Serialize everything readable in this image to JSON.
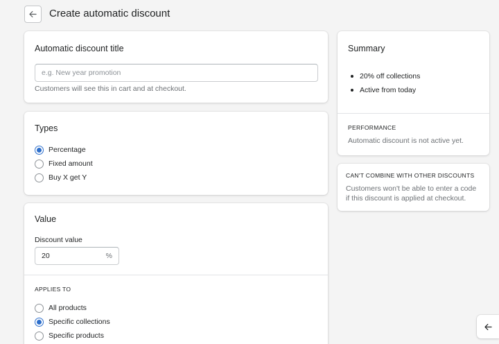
{
  "header": {
    "title": "Create automatic discount"
  },
  "title_card": {
    "title": "Automatic discount title",
    "input_placeholder": "e.g. New year promotion",
    "help_text": "Customers will see this in cart and at checkout."
  },
  "types_card": {
    "title": "Types",
    "options": [
      {
        "label": "Percentage",
        "checked": true
      },
      {
        "label": "Fixed amount",
        "checked": false
      },
      {
        "label": "Buy X get Y",
        "checked": false
      }
    ]
  },
  "value_card": {
    "title": "Value",
    "discount_label": "Discount value",
    "discount_value": "20",
    "discount_suffix": "%",
    "applies_to_label": "APPLIES TO",
    "applies_options": [
      {
        "label": "All products",
        "checked": false
      },
      {
        "label": "Specific collections",
        "checked": true
      },
      {
        "label": "Specific products",
        "checked": false
      }
    ]
  },
  "summary_card": {
    "title": "Summary",
    "items": [
      "20% off collections",
      "Active from today"
    ],
    "performance_label": "PERFORMANCE",
    "performance_text": "Automatic discount is not active yet."
  },
  "combine_card": {
    "label": "CAN'T COMBINE WITH OTHER DISCOUNTS",
    "text_line1": "Customers won't be able to enter a code",
    "text_line2": "if this discount is applied at checkout."
  },
  "icons": {
    "back": "arrow-left-icon",
    "floating": "arrow-left-icon"
  },
  "colors": {
    "accent": "#2c6ecb",
    "background": "#f4f4f4"
  }
}
